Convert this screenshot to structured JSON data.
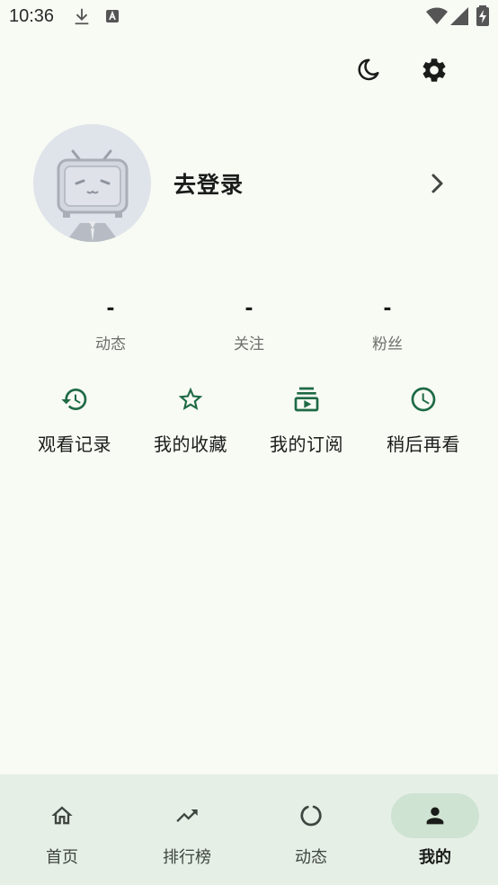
{
  "status_bar": {
    "time": "10:36",
    "icons": [
      "download-icon",
      "a-badge-icon",
      "wifi-icon",
      "signal-icon",
      "battery-charging-icon"
    ]
  },
  "header": {
    "actions": [
      "dark-mode-moon-icon",
      "settings-gear-icon"
    ]
  },
  "profile": {
    "login_text": "去登录",
    "avatar_icon": "tv-mascot-avatar"
  },
  "stats": [
    {
      "value": "-",
      "label": "动态"
    },
    {
      "value": "-",
      "label": "关注"
    },
    {
      "value": "-",
      "label": "粉丝"
    }
  ],
  "shortcuts": [
    {
      "label": "观看记录",
      "icon": "history-icon"
    },
    {
      "label": "我的收藏",
      "icon": "star-icon"
    },
    {
      "label": "我的订阅",
      "icon": "subscriptions-icon"
    },
    {
      "label": "稍后再看",
      "icon": "clock-icon"
    }
  ],
  "bottom_nav": {
    "items": [
      {
        "label": "首页",
        "icon": "home-icon",
        "active": false
      },
      {
        "label": "排行榜",
        "icon": "trending-icon",
        "active": false
      },
      {
        "label": "动态",
        "icon": "dynamic-circle-icon",
        "active": false
      },
      {
        "label": "我的",
        "icon": "person-icon",
        "active": true
      }
    ]
  },
  "colors": {
    "background": "#f8faf4",
    "accent": "#1e6a45",
    "nav_background": "#e6efe6",
    "nav_active_pill": "#cfe3d2"
  }
}
